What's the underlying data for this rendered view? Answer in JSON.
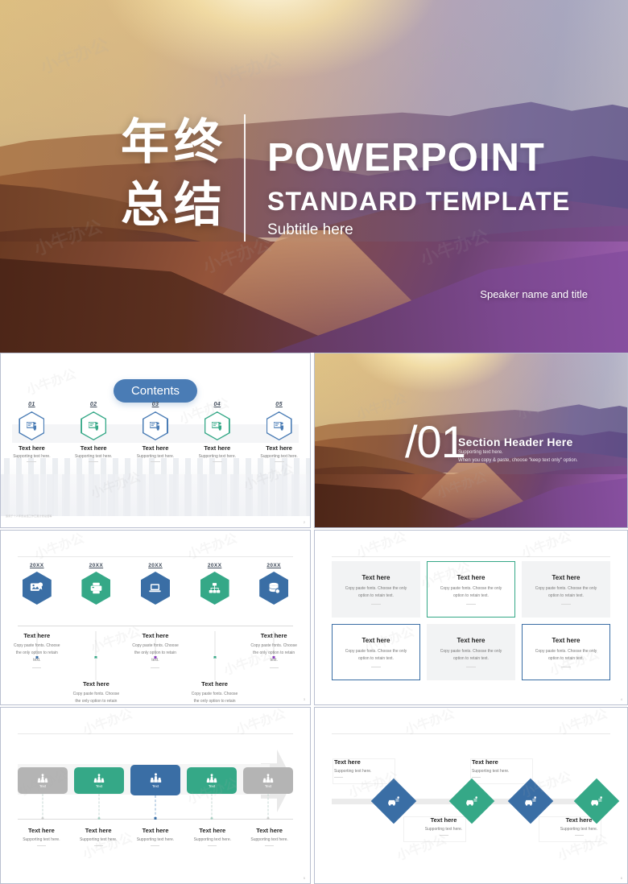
{
  "hero": {
    "cn_title": "年终总结",
    "title": "POWERPOINT",
    "subtitle": "STANDARD TEMPLATE",
    "tagline": "Subtitle here",
    "speaker": "Speaker name and title"
  },
  "contents_slide": {
    "button_label": "Contents",
    "page_number": "2",
    "footer_note": "适用于个人年终总结工作汇报计划总结等",
    "items": [
      {
        "num": "01",
        "title": "Text here",
        "support": "Supporting text here.",
        "icon": "presentation-person-icon",
        "color": "#4a7cb5"
      },
      {
        "num": "02",
        "title": "Text here",
        "support": "Supporting text here.",
        "icon": "presentation-person-icon",
        "color": "#35a887"
      },
      {
        "num": "03",
        "title": "Text here",
        "support": "Supporting text here.",
        "icon": "presentation-person-icon",
        "color": "#4a7cb5"
      },
      {
        "num": "04",
        "title": "Text here",
        "support": "Supporting text here.",
        "icon": "presentation-person-icon",
        "color": "#35a887"
      },
      {
        "num": "05",
        "title": "Text here",
        "support": "Supporting text here.",
        "icon": "presentation-person-icon",
        "color": "#4a7cb5"
      }
    ]
  },
  "section_slide": {
    "number": "/01",
    "header": "Section Header Here",
    "support_1": "Supporting text here.",
    "support_2": "When you copy & paste, choose \"keep text only\" option."
  },
  "timeline_slide": {
    "page_number": "3",
    "items": [
      {
        "year": "20XX",
        "title": "Text here",
        "body": "Copy paste fonts. Choose the only option to retain text.",
        "icon": "award-icon",
        "color": "#3a6ea5",
        "dot": "#3a6ea5",
        "position": "up"
      },
      {
        "year": "20XX",
        "title": "Text here",
        "body": "Copy paste fonts. Choose the only option to retain text.",
        "icon": "printer-icon",
        "color": "#35a887",
        "dot": "#35a887",
        "position": "down"
      },
      {
        "year": "20XX",
        "title": "Text here",
        "body": "Copy paste fonts. Choose the only option to retain text.",
        "icon": "laptop-icon",
        "color": "#3a6ea5",
        "dot": "#8b3fbf",
        "position": "up"
      },
      {
        "year": "20XX",
        "title": "Text here",
        "body": "Copy paste fonts. Choose the only option to retain text.",
        "icon": "org-chart-icon",
        "color": "#35a887",
        "dot": "#35a887",
        "position": "down"
      },
      {
        "year": "20XX",
        "title": "Text here",
        "body": "Copy paste fonts. Choose the only option to retain text.",
        "icon": "database-icon",
        "color": "#3a6ea5",
        "dot": "#8b3fbf",
        "position": "up"
      }
    ]
  },
  "boxes_slide": {
    "page_number": "4",
    "boxes": [
      {
        "title": "Text here",
        "body": "Copy paste fonts. Choose the only option to retain text.",
        "style": "gray"
      },
      {
        "title": "Text here",
        "body": "Copy paste fonts. Choose the only option to retain text.",
        "style": "green"
      },
      {
        "title": "Text here",
        "body": "Copy paste fonts. Choose the only option to retain text.",
        "style": "gray"
      },
      {
        "title": "Text here",
        "body": "Copy paste fonts. Choose the only option to retain text.",
        "style": "blue"
      },
      {
        "title": "Text here",
        "body": "Copy paste fonts. Choose the only option to retain text.",
        "style": "gray"
      },
      {
        "title": "Text here",
        "body": "Copy paste fonts. Choose the only option to retain text.",
        "style": "blue"
      }
    ]
  },
  "chevron_slide": {
    "page_number": "5",
    "items": [
      {
        "box_label": "Text",
        "title": "Text here",
        "support": "Supporting text here.",
        "color": "#b4b4b4",
        "icon": "team-idea-icon"
      },
      {
        "box_label": "Text",
        "title": "Text here",
        "support": "Supporting text here.",
        "color": "#35a887",
        "icon": "team-idea-icon"
      },
      {
        "box_label": "Text",
        "title": "Text here",
        "support": "Supporting text here.",
        "color": "#3a6ea5",
        "icon": "team-idea-icon"
      },
      {
        "box_label": "Text",
        "title": "Text here",
        "support": "Supporting text here.",
        "color": "#35a887",
        "icon": "team-idea-icon"
      },
      {
        "box_label": "Text",
        "title": "Text here",
        "support": "Supporting text here.",
        "color": "#b4b4b4",
        "icon": "team-idea-icon"
      }
    ]
  },
  "diamond_slide": {
    "page_number": "6",
    "items": [
      {
        "title": "Text here",
        "support": "Supporting text here.",
        "color": "#3a6ea5",
        "icon": "car-service-icon",
        "position": "up"
      },
      {
        "title": "Text here",
        "support": "Supporting text here.",
        "color": "#35a887",
        "icon": "car-service-icon",
        "position": "down"
      },
      {
        "title": "Text here",
        "support": "Supporting text here.",
        "color": "#3a6ea5",
        "icon": "car-service-icon",
        "position": "up"
      },
      {
        "title": "Text here",
        "support": "Supporting text here.",
        "color": "#35a887",
        "icon": "car-service-icon",
        "position": "down"
      }
    ]
  },
  "colors": {
    "blue": "#3a6ea5",
    "green": "#35a887",
    "gray": "#b4b4b4",
    "contents_button": "#4a7cb5"
  },
  "watermark": "小牛办公"
}
